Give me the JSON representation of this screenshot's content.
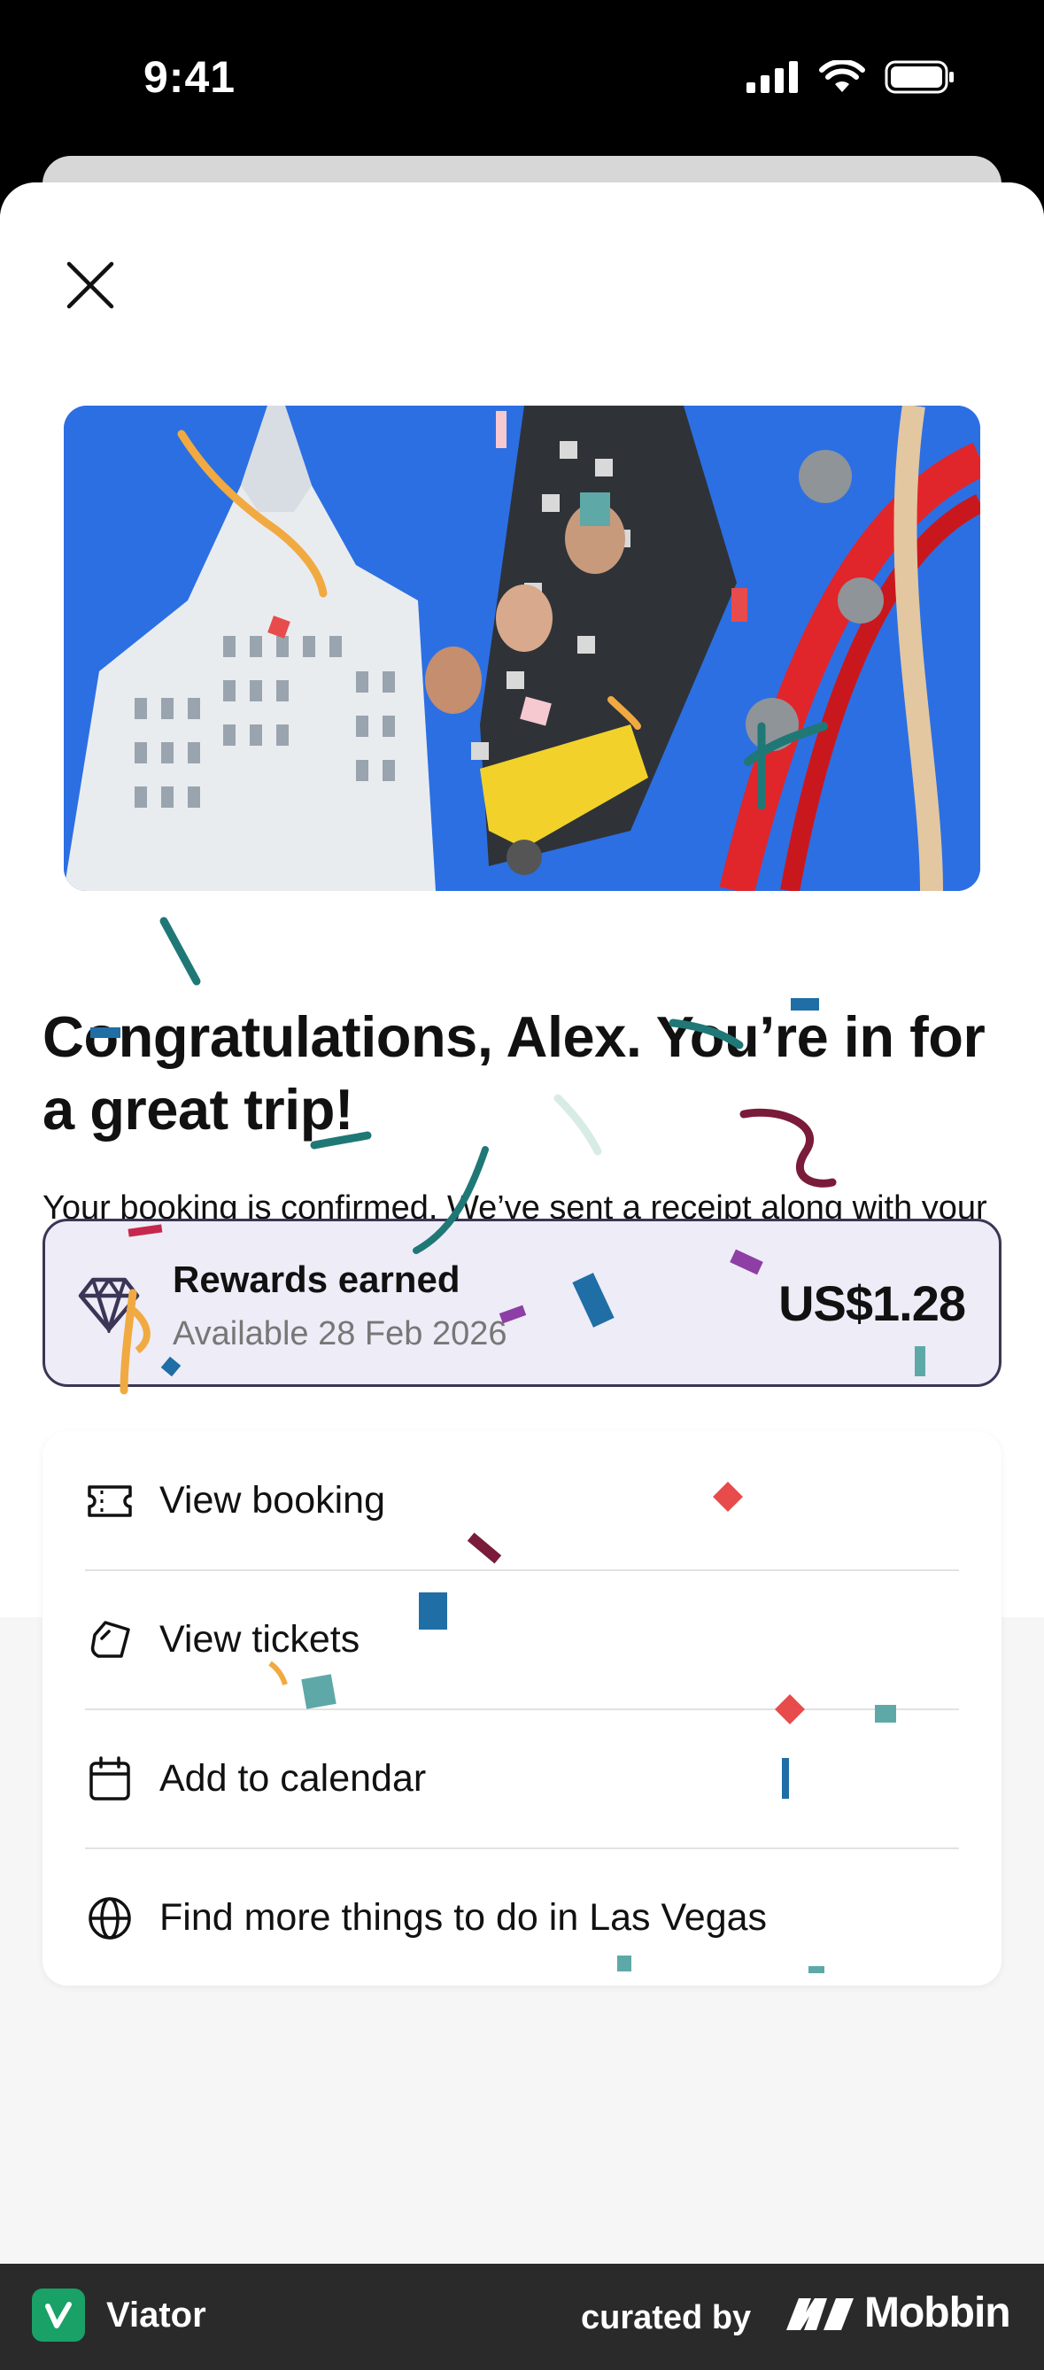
{
  "status_bar": {
    "time": "9:41"
  },
  "headline": "Congratulations, Alex. You’re in for a great trip!",
  "body": "Your booking is confirmed. We’ve sent a receipt along with your ticket details to alexsmith.mobbin@gmail.com. And fear not, you can always access your booking, even offline on the Viator app.",
  "rewards": {
    "title": "Rewards earned",
    "subtitle": "Available 28 Feb 2026",
    "amount": "US$1.28"
  },
  "actions": [
    {
      "label": "View booking",
      "icon": "ticket-icon"
    },
    {
      "label": "View tickets",
      "icon": "hand-ticket-icon"
    },
    {
      "label": "Add to calendar",
      "icon": "calendar-icon"
    },
    {
      "label": "Find more things to do in Las Vegas",
      "icon": "globe-icon"
    }
  ],
  "footer": {
    "app_name": "Viator",
    "curated_by": "curated by",
    "brand": "Mobbin"
  },
  "colors": {
    "rewards_bg": "#eeecf7",
    "rewards_border": "#3b3556",
    "viator_green": "#19a168"
  }
}
